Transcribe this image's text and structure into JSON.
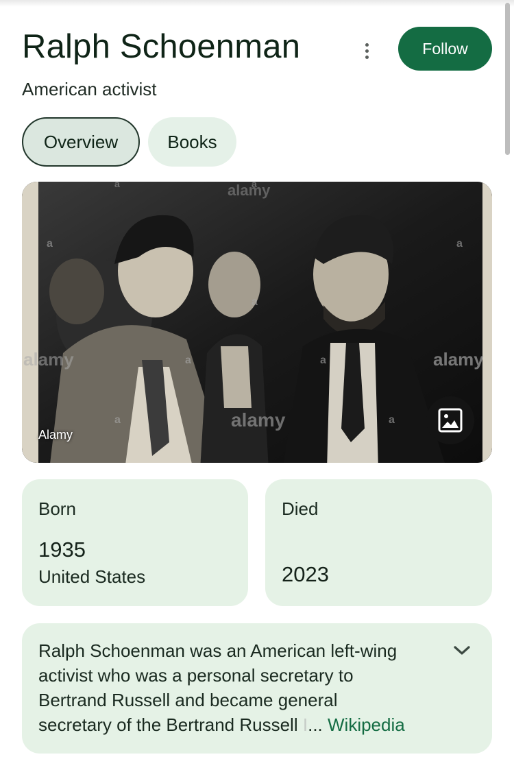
{
  "header": {
    "title": "Ralph Schoenman",
    "subtitle": "American activist",
    "follow_label": "Follow",
    "more_icon": "more-vert-icon"
  },
  "tabs": [
    {
      "label": "Overview",
      "selected": true
    },
    {
      "label": "Books",
      "selected": false
    }
  ],
  "image": {
    "source": "Alamy",
    "watermark": "alamy",
    "watermark_short": "a",
    "button_icon": "image-icon"
  },
  "facts": {
    "born": {
      "label": "Born",
      "year": "1935",
      "place": "United States"
    },
    "died": {
      "label": "Died",
      "year": "2023"
    }
  },
  "description": {
    "lines": [
      "Ralph Schoenman was an American left-wing",
      "activist who was a personal secretary to",
      "Bertrand Russell and became general",
      "secretary of the Bertrand Russell"
    ],
    "faded": "I",
    "ellipsis": "...",
    "source_link": "Wikipedia",
    "expand_icon": "chevron-down-icon"
  },
  "colors": {
    "accent": "#146c43",
    "card_background": "#e5f2e6",
    "tab_selected": "#dbe7df",
    "tab_unselected": "#e5f1e8"
  }
}
